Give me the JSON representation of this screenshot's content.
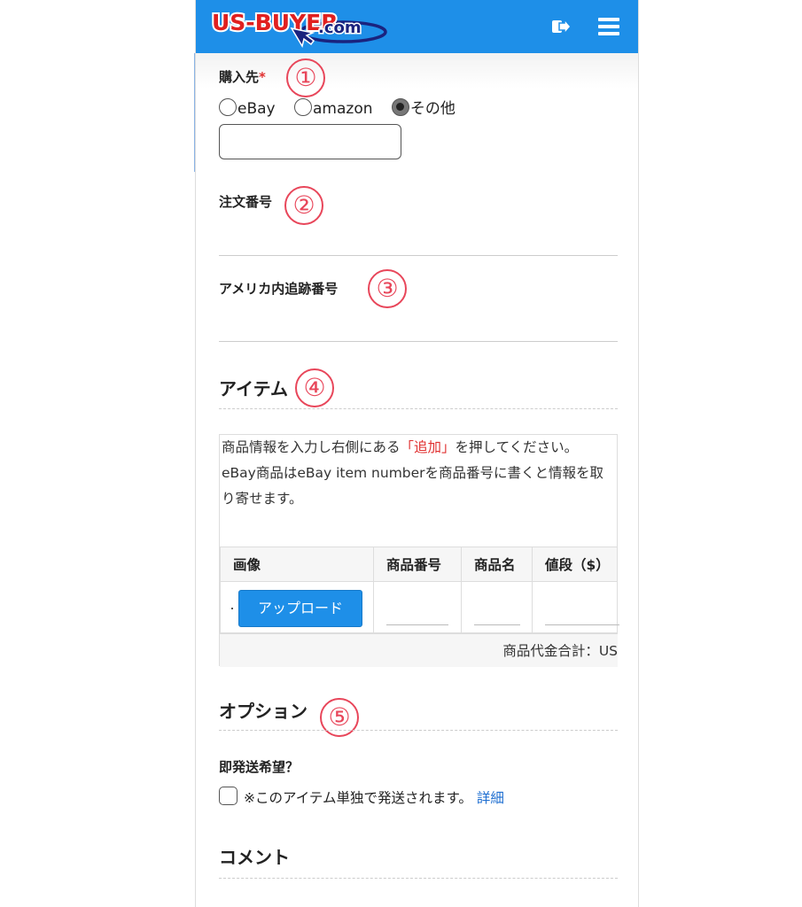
{
  "header": {
    "logo_text": "US-BUYER",
    "logo_suffix": ".com",
    "exit_icon": "exit-icon",
    "menu_icon": "hamburger-menu-icon",
    "bg_color": "#1e8fe8"
  },
  "purchase_source": {
    "label": "購入先",
    "required_mark": "*",
    "marker": "①",
    "options": [
      "eBay",
      "amazon",
      "その他"
    ],
    "selected": "その他",
    "other_value": ""
  },
  "order_number": {
    "label": "注文番号",
    "marker": "②"
  },
  "tracking_number": {
    "label": "アメリカ内追跡番号",
    "marker": "③"
  },
  "items": {
    "title": "アイテム",
    "marker": "④",
    "instruction_part1": "商品情報を入力し右側にある",
    "instruction_highlight": "「追加」",
    "instruction_part2": "を押してください。",
    "instruction_line2": "eBay商品はeBay item numberを商品番号に書くと情報を取り寄せます。",
    "columns": [
      "画像",
      "商品番号",
      "商品名",
      "値段（$）"
    ],
    "upload_button": "アップロード",
    "total_label": "商品代金合計：US"
  },
  "options": {
    "title": "オプション",
    "marker": "⑤",
    "express_label": "即発送希望？",
    "express_note": "※このアイテム単独で発送されます。",
    "detail_link": "詳細"
  },
  "comment": {
    "title": "コメント"
  },
  "colors": {
    "accent": "#1e8fe8",
    "marker": "#e8465a",
    "required": "#e03030",
    "link": "#1f6fd1"
  }
}
